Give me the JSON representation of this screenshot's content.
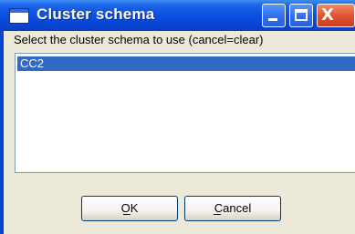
{
  "window": {
    "title": "Cluster schema",
    "close_glyph": "X"
  },
  "dialog": {
    "prompt": "Select the cluster schema to use (cancel=clear)",
    "list": {
      "items": [
        {
          "label": "CC2",
          "selected": true
        }
      ]
    },
    "ok_label": "OK",
    "cancel_label": "Cancel"
  },
  "icons": {
    "title_icon": "window-app-icon",
    "minimize": "minimize-icon",
    "maximize": "maximize-icon",
    "close": "close-icon"
  },
  "colors": {
    "titlebar": "#0a4ee0",
    "close_button": "#e0512e",
    "selection": "#316ac5",
    "dialog_background": "#ece9d8"
  }
}
